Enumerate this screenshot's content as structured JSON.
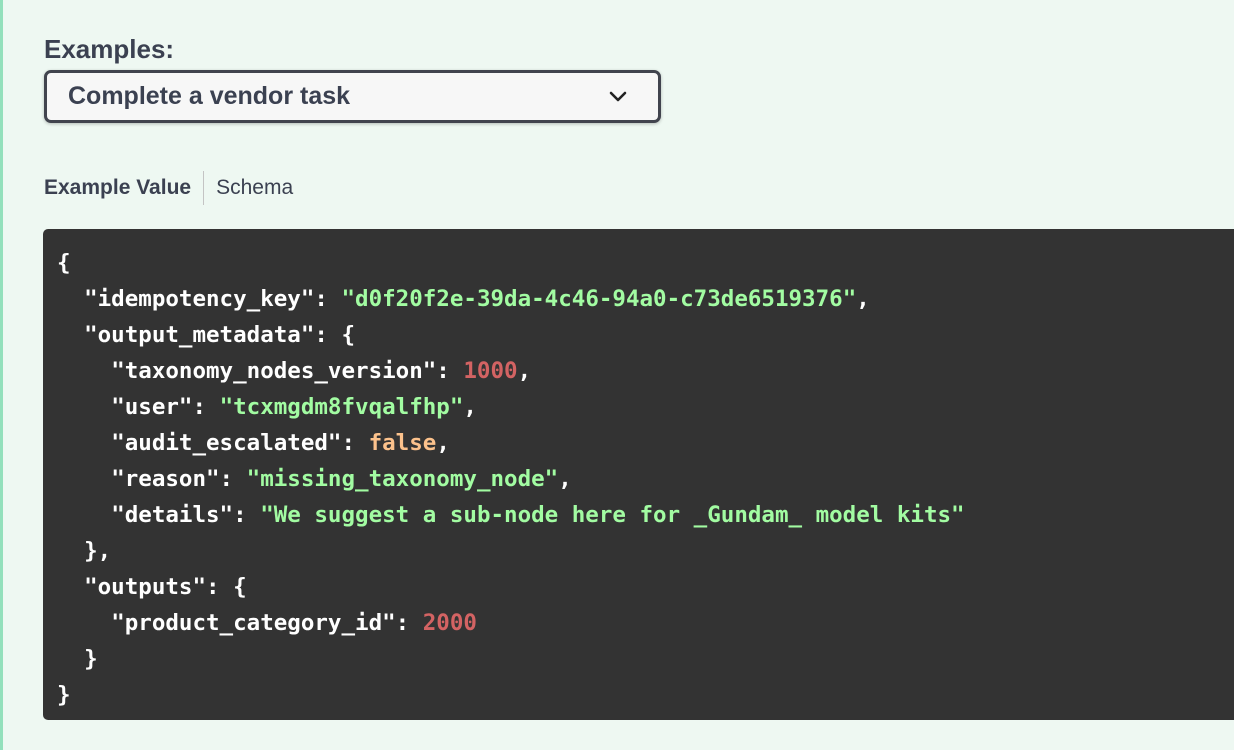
{
  "examples": {
    "label": "Examples:",
    "selected": "Complete a vendor task"
  },
  "tabs": {
    "example_value": "Example Value",
    "schema": "Schema"
  },
  "code": {
    "idempotency_key": "\"d0f20f2e-39da-4c46-94a0-c73de6519376\"",
    "taxonomy_nodes_version": "1000",
    "user": "\"tcxmgdm8fvqalfhp\"",
    "audit_escalated": "false",
    "reason": "\"missing_taxonomy_node\"",
    "details": "\"We suggest a sub-node here for _Gundam_ model kits\"",
    "product_category_id": "2000"
  },
  "colors": {
    "background": "#eef8f2",
    "code_background": "#333333",
    "string": "#a2fca2",
    "number": "#d36363",
    "boolean": "#fcc28c"
  }
}
